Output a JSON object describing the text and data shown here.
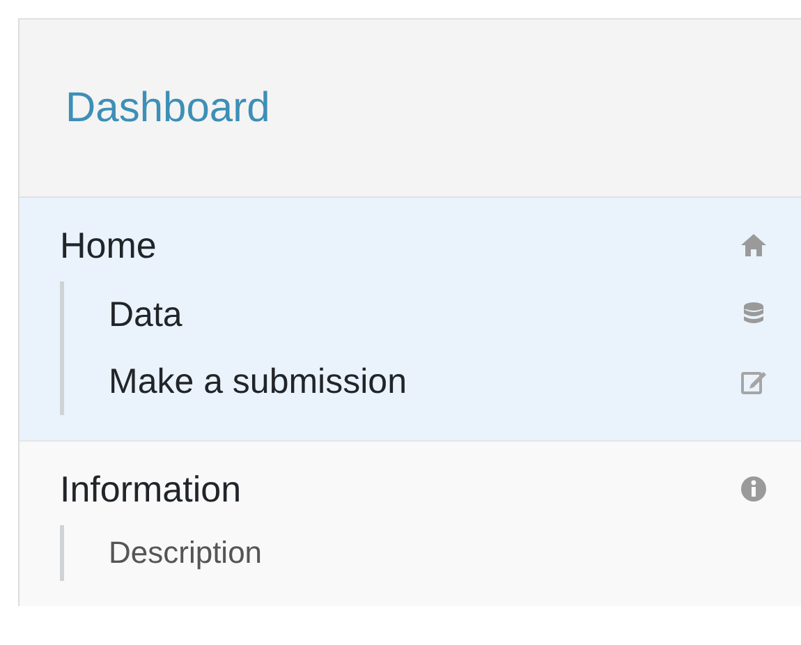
{
  "title": "Dashboard",
  "sections": [
    {
      "label": "Home",
      "selected": true,
      "children": [
        {
          "label": "Data"
        },
        {
          "label": "Make a submission"
        }
      ]
    },
    {
      "label": "Information",
      "selected": false,
      "children": [
        {
          "label": "Description"
        }
      ]
    }
  ]
}
